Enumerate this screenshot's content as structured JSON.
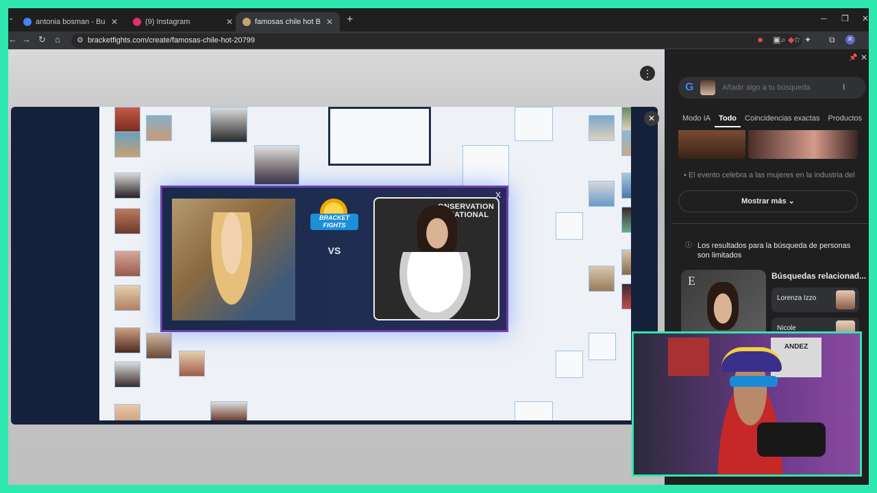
{
  "tabs": [
    {
      "title": "antonia bosman - Buscar con G",
      "favicon_color": "#4285f4"
    },
    {
      "title": "(9) Instagram",
      "favicon_color": "#e1306c"
    },
    {
      "title": "famosas chile hot Bracket - Bra",
      "favicon_color": "#c9a56a"
    }
  ],
  "address": {
    "url": "bracketfights.com/create/famosas-chile-hot-20799"
  },
  "modal": {
    "logo_text": "BRACKET FIGHTS",
    "vs_label": "VS",
    "close_label": "X",
    "right_sign": "ONSERVATION\nERNATIONAL"
  },
  "lens": {
    "search_placeholder": "Añadir algo a tu búsqueda",
    "tabs": [
      "Modo IA",
      "Todo",
      "Coincidencias exactas",
      "Productos"
    ],
    "active_tab": "Todo",
    "snippet": "El evento celebra a las mujeres en la industria del",
    "more_label": "Mostrar más",
    "limit_note": "Los resultados para la búsqueda de personas son limitados",
    "related_title": "Búsquedas relacionad...",
    "related": [
      {
        "name": "Lorenza Izzo"
      },
      {
        "name": "Nicole Sabarinnos"
      }
    ]
  },
  "webcam": {
    "poster_text": "ANDEZ"
  }
}
